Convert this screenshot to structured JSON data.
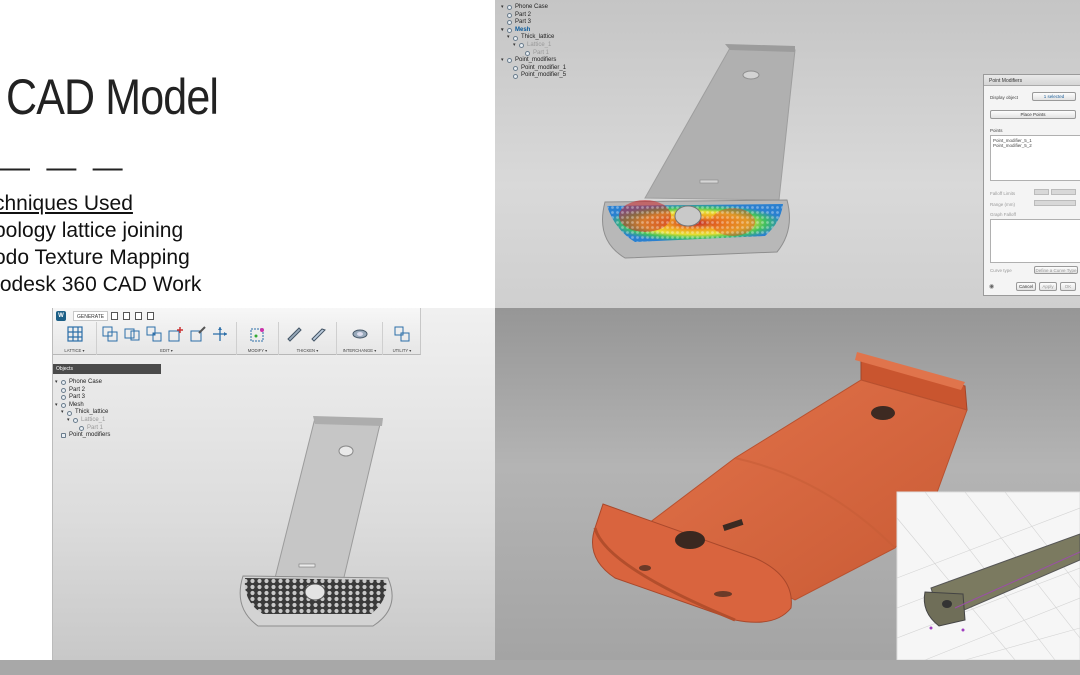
{
  "slide": {
    "title": "CAD Model",
    "rule": "— — —",
    "techniques_heading": "chniques Used",
    "techniques": [
      "pology lattice joining",
      "odo Texture Mapping",
      "todesk 360 CAD Work"
    ]
  },
  "top_tree": {
    "items": [
      {
        "label": "Phone Case"
      },
      {
        "label": "Part 2"
      },
      {
        "label": "Part 3"
      },
      {
        "label": "Mesh"
      },
      {
        "label": "Thick_lattice"
      },
      {
        "label": "Lattice_1"
      },
      {
        "label": "Part 1"
      },
      {
        "label": "Point_modifiers"
      },
      {
        "label": "Point_modifier_1"
      },
      {
        "label": "Point_modifier_5"
      }
    ]
  },
  "dialog": {
    "title": "Point Modifiers",
    "display_object_label": "Display object",
    "display_object_value": "1 selected",
    "place_points_button": "Place Points",
    "points_label": "Points",
    "points": [
      "Point_modifier_5_1",
      "Point_modifier_5_2"
    ],
    "falloff_label": "Falloff Limits",
    "range_label": "Range (mm)",
    "graph_label": "Graph Falloff",
    "curve_type_label": "Curve type",
    "curve_type_value": "Define a Curve Type",
    "cancel_button": "Cancel",
    "apply_button": "Apply",
    "ok_button": "OK"
  },
  "toolbar": {
    "logo": "W",
    "mode": "GENERATE",
    "groups": [
      "LATTICE ▾",
      "EDIT ▾",
      "MODIFY ▾",
      "THICKEN ▾",
      "INTERCHANGE ▾",
      "UTILITY ▾"
    ]
  },
  "objects_panel": {
    "header": "Objects",
    "items": [
      {
        "label": "Phone Case"
      },
      {
        "label": "Part 2"
      },
      {
        "label": "Part 3"
      },
      {
        "label": "Mesh"
      },
      {
        "label": "Thick_lattice"
      },
      {
        "label": "Lattice_1"
      },
      {
        "label": "Part 1"
      },
      {
        "label": "Point_modifiers"
      }
    ]
  },
  "colors": {
    "orange_model": "#d9643e",
    "orange_dark": "#b8512f",
    "grey_model": "#bcbcbc",
    "selection_blue": "#0a5a9a"
  }
}
